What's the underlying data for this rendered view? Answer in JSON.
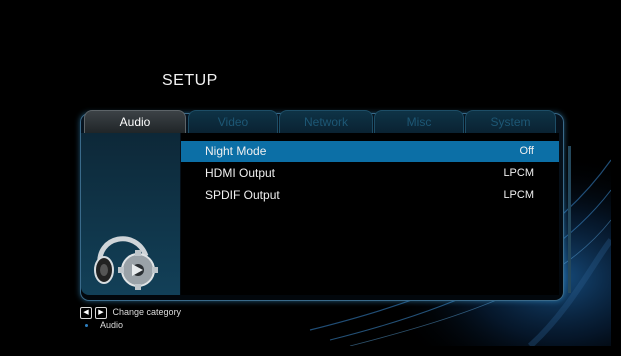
{
  "header": {
    "title": "SETUP"
  },
  "tabs": [
    {
      "label": "Audio",
      "active": true
    },
    {
      "label": "Video",
      "active": false
    },
    {
      "label": "Network",
      "active": false
    },
    {
      "label": "Misc",
      "active": false
    },
    {
      "label": "System",
      "active": false
    }
  ],
  "settings": [
    {
      "label": "Night Mode",
      "value": "Off",
      "selected": true
    },
    {
      "label": "HDMI Output",
      "value": "LPCM",
      "selected": false
    },
    {
      "label": "SPDIF Output",
      "value": "LPCM",
      "selected": false
    }
  ],
  "sidebar": {
    "icon": "audio-headphones-gear-icon"
  },
  "hints": {
    "change_category": "Change category",
    "current_category": "Audio",
    "left_key_icon": "arrow-left-key-icon",
    "right_key_icon": "arrow-right-key-icon"
  },
  "colors": {
    "selection": "#0c6fa6",
    "accent_glow": "#3ca0dc",
    "inactive_tab_text": "#1d5775"
  }
}
